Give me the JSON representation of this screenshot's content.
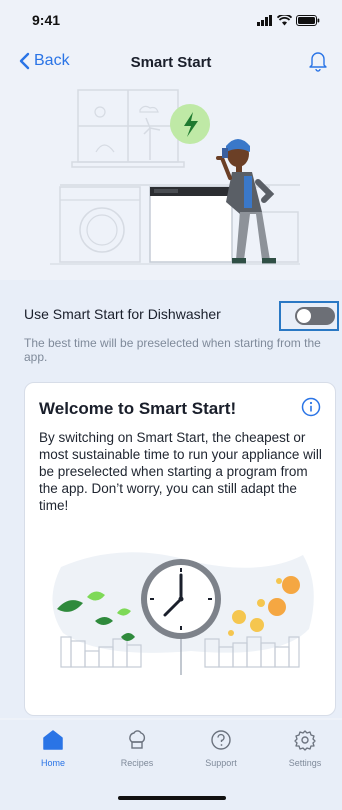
{
  "status_bar": {
    "time": "9:41"
  },
  "nav": {
    "back_label": "Back",
    "title": "Smart Start"
  },
  "setting": {
    "toggle_label": "Use Smart Start for Dishwasher",
    "toggle_on": false,
    "description": "The best time will be preselected when starting from the app."
  },
  "card": {
    "title": "Welcome to Smart Start!",
    "body": "By switching on Smart Start, the cheapest or most sustainable time to run your appliance will be preselected when starting a program from the app. Don’t worry, you can still adapt the time!"
  },
  "tabs": [
    {
      "label": "Home",
      "icon": "home-icon",
      "active": true
    },
    {
      "label": "Recipes",
      "icon": "chef-hat-icon",
      "active": false
    },
    {
      "label": "Support",
      "icon": "help-icon",
      "active": false
    },
    {
      "label": "Settings",
      "icon": "gear-icon",
      "active": false
    }
  ],
  "colors": {
    "accent": "#2a74e6",
    "toggle_off": "#6c6f76",
    "highlight_border": "#2a78c4",
    "lime": "#7ed957"
  }
}
